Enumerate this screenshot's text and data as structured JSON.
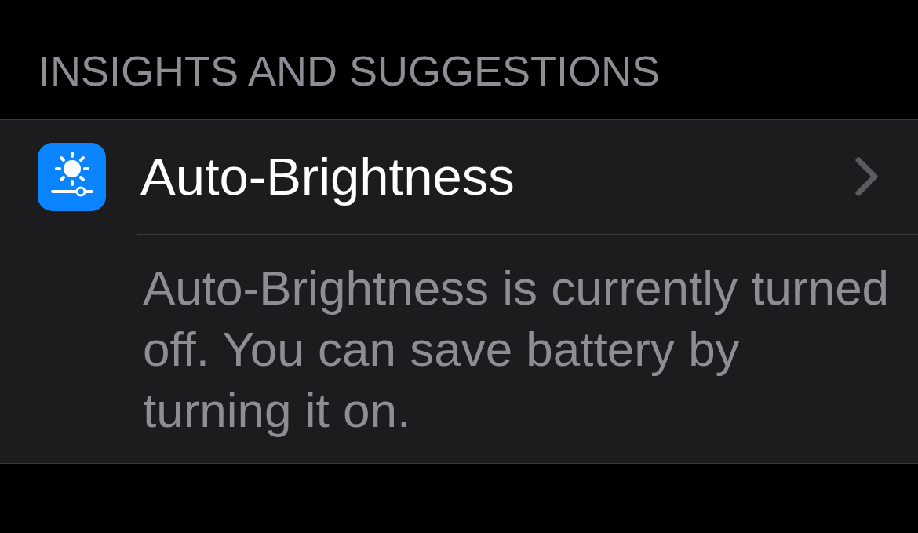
{
  "section_header": "INSIGHTS AND SUGGESTIONS",
  "rows": [
    {
      "kind": "link",
      "title": "Auto-Brightness",
      "description": "Auto-Brightness is currently turned off. You can save battery by turning it on."
    }
  ]
}
